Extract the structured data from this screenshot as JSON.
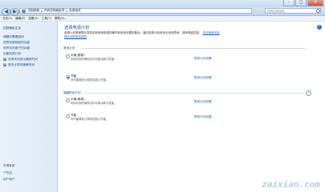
{
  "window": {
    "minimize": "–",
    "maximize": "□",
    "close": "✕"
  },
  "nav": {
    "back": "◀",
    "forward": "▶",
    "breadcrumb": [
      "控制面板",
      "所有控制面板项",
      "电源选项"
    ],
    "separator": "▸",
    "search_placeholder": "搜索控制面板"
  },
  "menu": [
    "文件(F)",
    "编辑(E)",
    "查看(V)",
    "工具(T)",
    "帮助(H)"
  ],
  "sidebar": {
    "home": "控制面板主页",
    "links": [
      "唤醒时需要密码",
      "选择电源按钮的功能",
      "选择关闭盖子的功能",
      "创建电源计划",
      "选择关闭显示器的时间",
      "更改计算机睡眠时间"
    ],
    "see_also_title": "另请参阅",
    "see_also": [
      "个性化",
      "用户帐户"
    ]
  },
  "main": {
    "title": "选择电源计划",
    "intro": "电源计划是管理计算机如何使用电源的硬件和系统设置的集合。通过选择计划来延长电池寿命，或获得高性能。",
    "intro_link": "告诉我有关电源计划的更多信息",
    "help": "?",
    "group1": "首选计划",
    "plans1": [
      {
        "name": "平衡(推荐)",
        "desc": "利用可用的硬件自动平衡功耗与性能。",
        "change": "更改计划设置",
        "selected": false
      },
      {
        "name": "节能",
        "desc": "尽可能降低计算机性能以节能。",
        "change": "更改计划设置",
        "selected": true
      }
    ],
    "group2": "隐藏附加计划",
    "plans2": [
      {
        "name": "平衡(推荐)",
        "desc": "利用可用的硬件自动平衡功耗与性能。",
        "change": "更改计划设置",
        "selected": false
      },
      {
        "name": "节能",
        "desc": "尽可能降低计算机性能以节能。",
        "change": "更改计划设置",
        "selected": false
      }
    ]
  },
  "watermark": "zaixian.com"
}
